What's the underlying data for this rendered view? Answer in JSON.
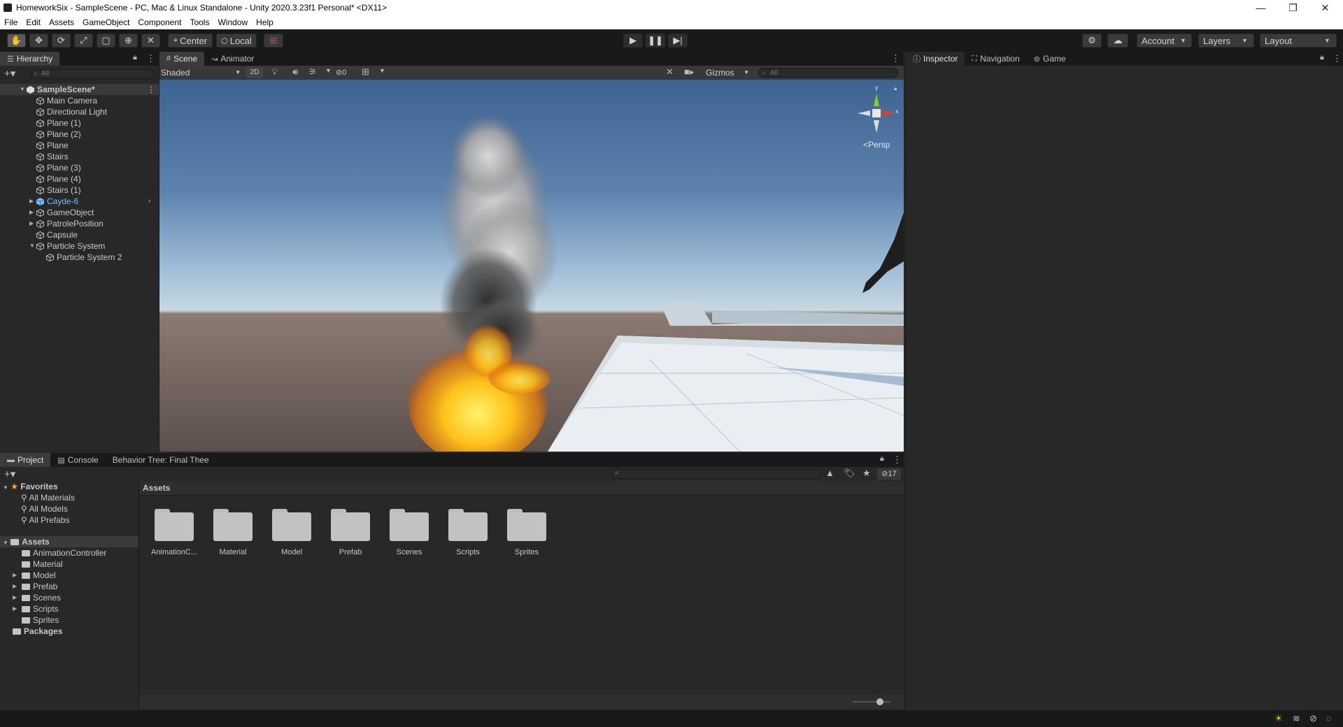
{
  "window": {
    "title": "HomeworkSix - SampleScene - PC, Mac & Linux Standalone - Unity 2020.3.23f1 Personal* <DX11>",
    "minimize": "—",
    "maximize": "❐",
    "close": "✕"
  },
  "menu": [
    "File",
    "Edit",
    "Assets",
    "GameObject",
    "Component",
    "Tools",
    "Window",
    "Help"
  ],
  "toolbar": {
    "tools": [
      "hand-tool",
      "move-tool",
      "rotate-tool",
      "scale-tool",
      "rect-tool",
      "transform-tool",
      "custom-tool"
    ],
    "pivot_mode": "Center",
    "pivot_rotation": "Local",
    "account": "Account",
    "layers": "Layers",
    "layout": "Layout"
  },
  "hierarchy": {
    "tab": "Hierarchy",
    "search_placeholder": "All",
    "items": [
      {
        "label": "SampleScene*",
        "depth": 0,
        "expanded": true,
        "bold": true
      },
      {
        "label": "Main Camera",
        "depth": 1
      },
      {
        "label": "Directional Light",
        "depth": 1
      },
      {
        "label": "Plane (1)",
        "depth": 1
      },
      {
        "label": "Plane (2)",
        "depth": 1
      },
      {
        "label": "Plane",
        "depth": 1
      },
      {
        "label": "Stairs",
        "depth": 1
      },
      {
        "label": "Plane (3)",
        "depth": 1
      },
      {
        "label": "Plane (4)",
        "depth": 1
      },
      {
        "label": "Stairs (1)",
        "depth": 1
      },
      {
        "label": "Cayde-6",
        "depth": 1,
        "collapsed": true,
        "prefab": true
      },
      {
        "label": "GameObject",
        "depth": 1,
        "collapsed": true
      },
      {
        "label": "PatrolePosition",
        "depth": 1,
        "collapsed": true
      },
      {
        "label": "Capsule",
        "depth": 1
      },
      {
        "label": "Particle System",
        "depth": 1,
        "expanded": true
      },
      {
        "label": "Particle System 2",
        "depth": 2
      }
    ]
  },
  "scene": {
    "tabs": [
      "Scene",
      "Animator"
    ],
    "shading_mode": "Shaded",
    "mode_2d": "2D",
    "hidden_count": "0",
    "gizmos": "Gizmos",
    "search_placeholder": "All",
    "projection_label": "Persp",
    "axis_y": "y",
    "axis_x": "x"
  },
  "inspector": {
    "tabs": [
      "Inspector",
      "Navigation",
      "Game"
    ]
  },
  "project": {
    "tabs": [
      "Project",
      "Console",
      "Behavior Tree: Final Thee"
    ],
    "hidden_count": "17",
    "breadcrumb": "Assets",
    "favorites": {
      "label": "Favorites",
      "items": [
        "All Materials",
        "All Models",
        "All Prefabs"
      ]
    },
    "tree": {
      "root": "Assets",
      "children": [
        {
          "label": "AnimationController",
          "has_children": false
        },
        {
          "label": "Material",
          "has_children": false
        },
        {
          "label": "Model",
          "has_children": true
        },
        {
          "label": "Prefab",
          "has_children": true
        },
        {
          "label": "Scenes",
          "has_children": true
        },
        {
          "label": "Scripts",
          "has_children": true
        },
        {
          "label": "Sprites",
          "has_children": false
        }
      ],
      "packages": "Packages"
    },
    "folders": [
      "AnimationC...",
      "Material",
      "Model",
      "Prefab",
      "Scenes",
      "Scripts",
      "Sprites"
    ],
    "zoom_slider": 0.72
  },
  "colors": {
    "accent_blue": "#4a8fe0",
    "prefab_blue": "#7cb9ff",
    "selection": "#3a3a3a",
    "panel_bg": "#282828",
    "toolbar_bg": "#191919"
  }
}
